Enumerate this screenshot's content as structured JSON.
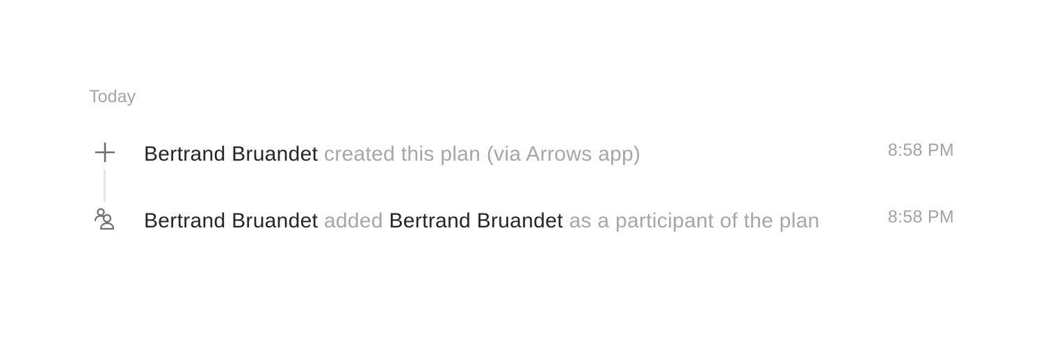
{
  "activity": {
    "date_label": "Today",
    "items": [
      {
        "icon": "plus-icon",
        "actor": "Bertrand Bruandet",
        "action": " created this plan (via Arrows app)",
        "time": "8:58 PM"
      },
      {
        "icon": "participants-icon",
        "actor": "Bertrand Bruandet",
        "action": " added ",
        "target": "Bertrand Bruandet",
        "suffix": " as a participant of the plan",
        "time": "8:58 PM"
      }
    ]
  }
}
